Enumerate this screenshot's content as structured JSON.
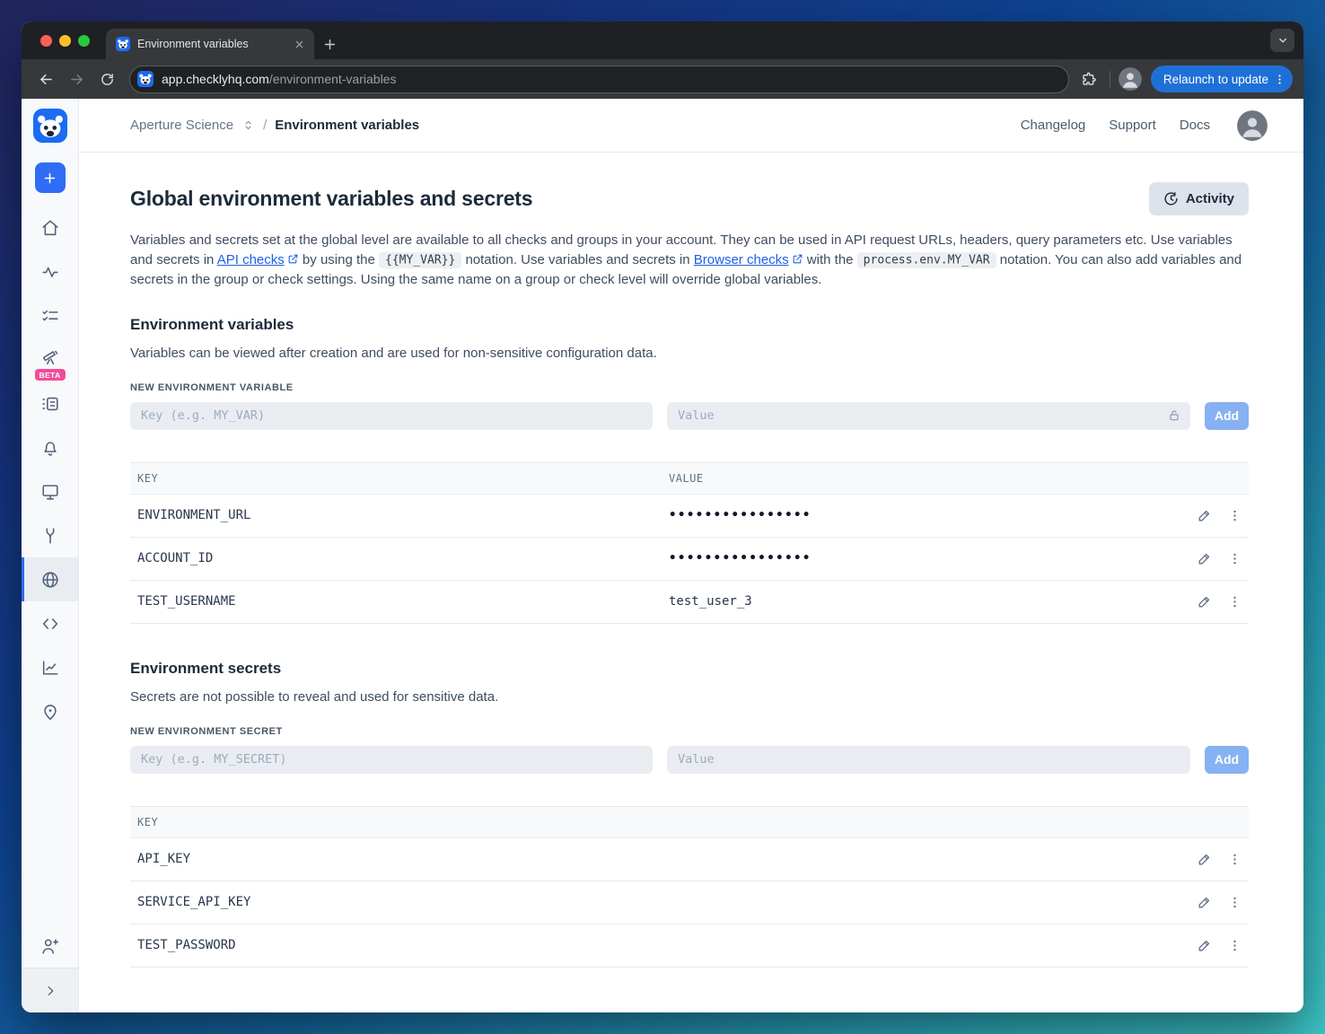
{
  "browser": {
    "tab": {
      "title": "Environment variables"
    },
    "url": {
      "host": "app.checklyhq.com",
      "path": "/environment-variables"
    },
    "relaunch_button": "Relaunch to update"
  },
  "app_header": {
    "account_name": "Aperture Science",
    "separator": "/",
    "page_name": "Environment variables",
    "nav": [
      {
        "label": "Changelog"
      },
      {
        "label": "Support"
      },
      {
        "label": "Docs"
      }
    ]
  },
  "sidebar": {
    "beta_badge": "BETA"
  },
  "main": {
    "title": "Global environment variables and secrets",
    "activity_button": "Activity",
    "intro": {
      "part1": "Variables and secrets set at the global level are available to all checks and groups in your account. They can be used in API request URLs, headers, query parameters etc. Use variables and secrets in ",
      "link_api": "API checks",
      "part2": " by using the ",
      "code_var": "{{MY_VAR}}",
      "part3": " notation. Use variables and secrets in ",
      "link_browser": "Browser checks",
      "part4": " with the ",
      "code_env": "process.env.MY_VAR",
      "part5": " notation. You can also add variables and secrets in the group or check settings. Using the same name on a group or check level will override global variables."
    },
    "variables": {
      "heading": "Environment variables",
      "description": "Variables can be viewed after creation and are used for non-sensitive configuration data.",
      "form_label": "NEW ENVIRONMENT VARIABLE",
      "key_placeholder": "Key (e.g. MY_VAR)",
      "value_placeholder": "Value",
      "add_button": "Add",
      "columns": {
        "key": "KEY",
        "value": "VALUE"
      },
      "rows": [
        {
          "key": "ENVIRONMENT_URL",
          "value": "••••••••••••••••"
        },
        {
          "key": "ACCOUNT_ID",
          "value": "••••••••••••••••"
        },
        {
          "key": "TEST_USERNAME",
          "value": "test_user_3"
        }
      ]
    },
    "secrets": {
      "heading": "Environment secrets",
      "description": "Secrets are not possible to reveal and used for sensitive data.",
      "form_label": "NEW ENVIRONMENT SECRET",
      "key_placeholder": "Key (e.g. MY_SECRET)",
      "value_placeholder": "Value",
      "add_button": "Add",
      "columns": {
        "key": "KEY"
      },
      "rows": [
        {
          "key": "API_KEY"
        },
        {
          "key": "SERVICE_API_KEY"
        },
        {
          "key": "TEST_PASSWORD"
        }
      ]
    }
  },
  "colors": {
    "brand_blue": "#1b6bf5",
    "sidebar_active_accent": "#2f6bf0",
    "beta_badge": "#ee4d9b",
    "add_button": "#86b1f3",
    "relaunch_button": "#1f70d6",
    "link": "#2060e8"
  }
}
